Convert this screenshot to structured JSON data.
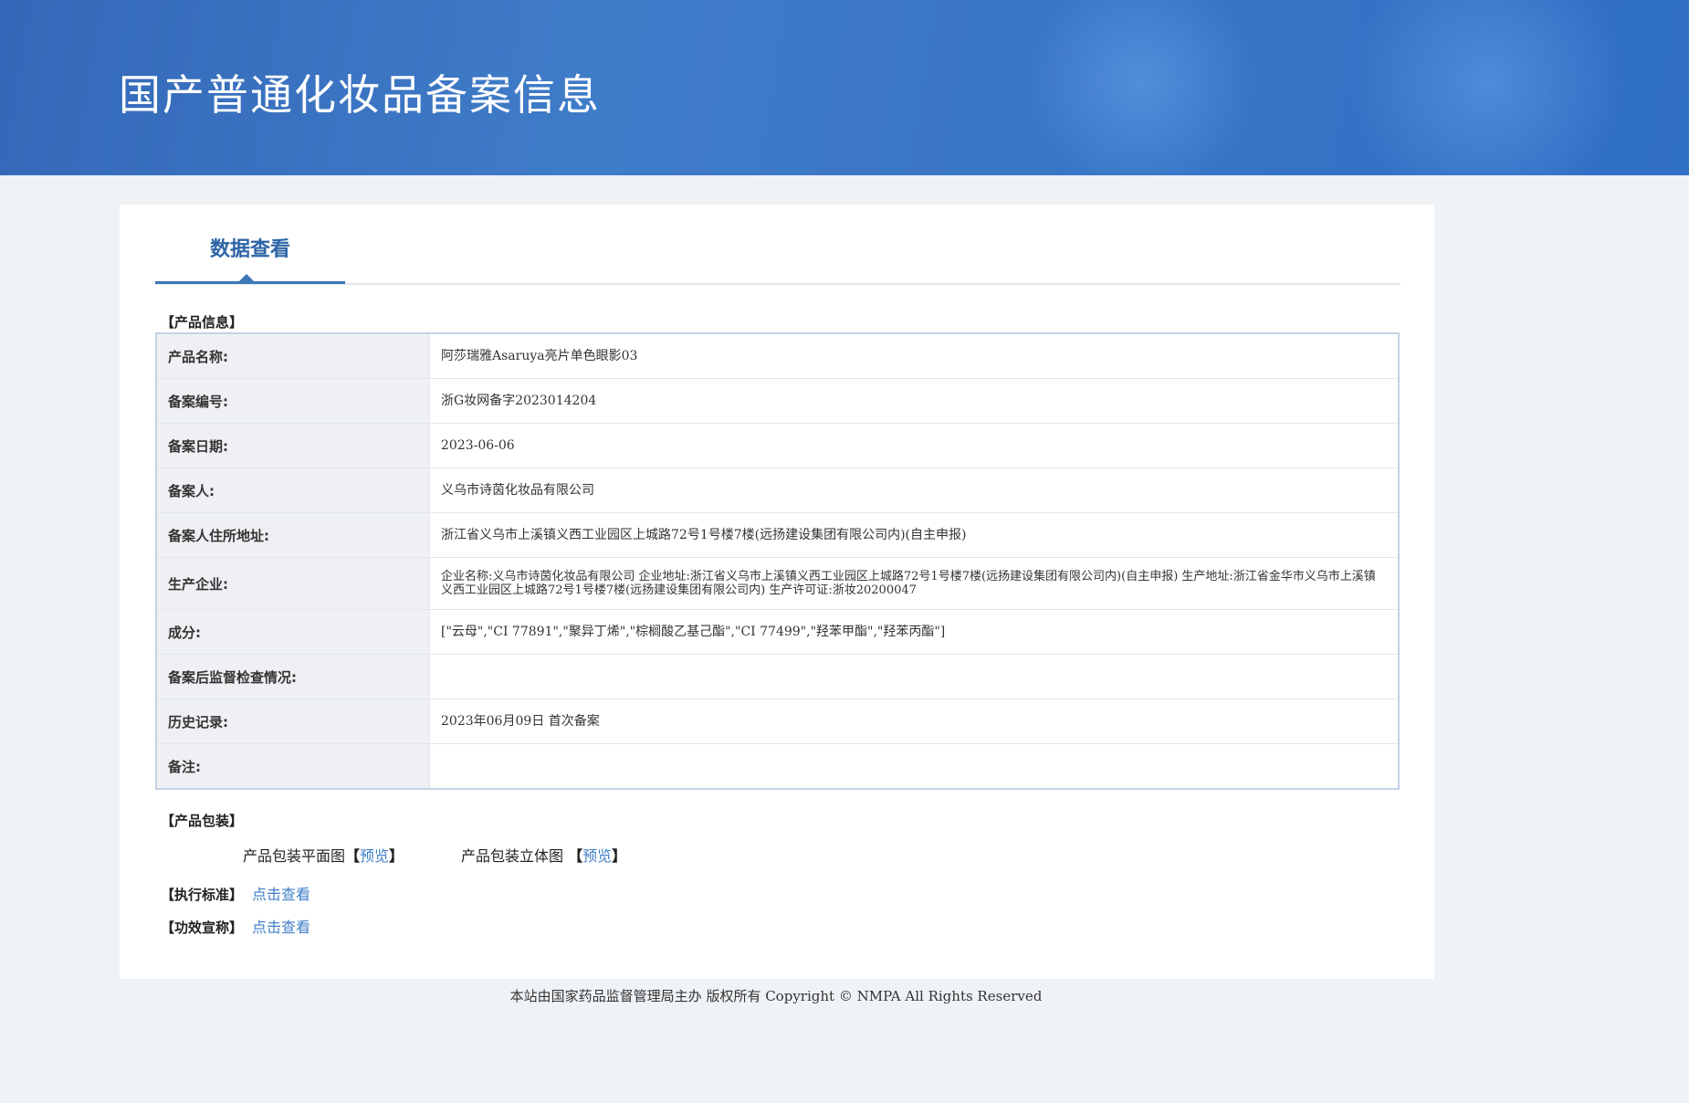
{
  "header": {
    "title": "国产普通化妆品备案信息"
  },
  "tabs": [
    {
      "label": "数据查看"
    }
  ],
  "product_info": {
    "section_title": "【产品信息】",
    "rows": [
      {
        "label": "产品名称:",
        "value": "阿莎瑞雅Asaruya亮片单色眼影03"
      },
      {
        "label": "备案编号:",
        "value": "浙G妆网备字2023014204"
      },
      {
        "label": "备案日期:",
        "value": "2023-06-06"
      },
      {
        "label": "备案人:",
        "value": "义乌市诗茵化妆品有限公司"
      },
      {
        "label": "备案人住所地址:",
        "value": "浙江省义乌市上溪镇义西工业园区上城路72号1号楼7楼(远扬建设集团有限公司内)(自主申报)"
      },
      {
        "label": "生产企业:",
        "value": "企业名称:义乌市诗茵化妆品有限公司 企业地址:浙江省义乌市上溪镇义西工业园区上城路72号1号楼7楼(远扬建设集团有限公司内)(自主申报) 生产地址:浙江省金华市义乌市上溪镇义西工业园区上城路72号1号楼7楼(远扬建设集团有限公司内) 生产许可证:浙妆20200047"
      },
      {
        "label": "成分:",
        "value": "[\"云母\",\"CI 77891\",\"聚异丁烯\",\"棕榈酸乙基己酯\",\"CI 77499\",\"羟苯甲酯\",\"羟苯丙酯\"]"
      },
      {
        "label": "备案后监督检查情况:",
        "value": ""
      },
      {
        "label": "历史记录:",
        "value": "2023年06月09日 首次备案"
      },
      {
        "label": "备注:",
        "value": ""
      }
    ]
  },
  "packaging": {
    "section_title": "【产品包装】",
    "flat_label": "产品包装平面图",
    "flat_link": "预览",
    "stereo_label": "产品包装立体图",
    "stereo_link": "预览",
    "open_bracket": "【",
    "close_bracket": "】"
  },
  "standard": {
    "label": "【执行标准】",
    "link": "点击查看"
  },
  "efficacy": {
    "label": "【功效宣称】",
    "link": "点击查看"
  },
  "footer": {
    "text": "本站由国家药品监督管理局主办 版权所有 Copyright © NMPA All Rights Reserved"
  }
}
